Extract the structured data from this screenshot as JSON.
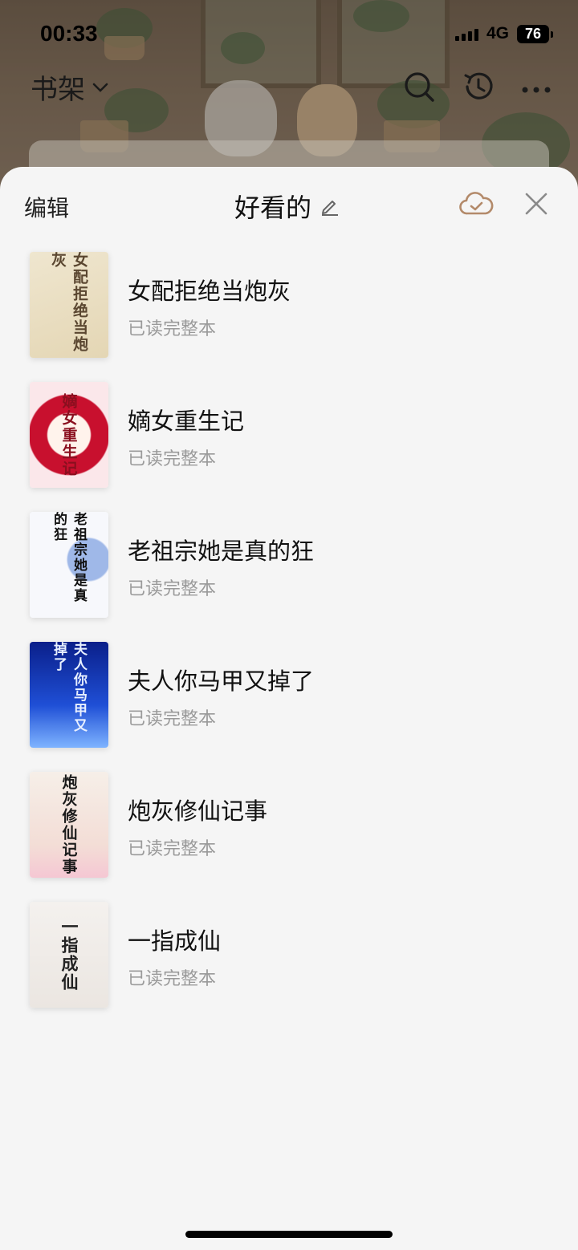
{
  "status_bar": {
    "time": "00:33",
    "network": "4G",
    "battery": "76"
  },
  "nav": {
    "shelf_label": "书架",
    "icons": [
      "search-icon",
      "history-icon",
      "more-icon"
    ]
  },
  "sheet": {
    "edit_label": "编辑",
    "title": "好看的",
    "icons": [
      "pencil-icon",
      "cloud-check-icon",
      "close-icon"
    ]
  },
  "books": [
    {
      "title": "女配拒绝当炮灰",
      "status": "已读完整本"
    },
    {
      "title": "嫡女重生记",
      "status": "已读完整本"
    },
    {
      "title": "老祖宗她是真的狂",
      "status": "已读完整本"
    },
    {
      "title": "夫人你马甲又掉了",
      "status": "已读完整本"
    },
    {
      "title": "炮灰修仙记事",
      "status": "已读完整本"
    },
    {
      "title": "一指成仙",
      "status": "已读完整本"
    }
  ],
  "colors": {
    "sheet_bg": "#f5f5f5",
    "status_gray": "#9a9a9a",
    "cloud_accent": "#b38a6a"
  }
}
